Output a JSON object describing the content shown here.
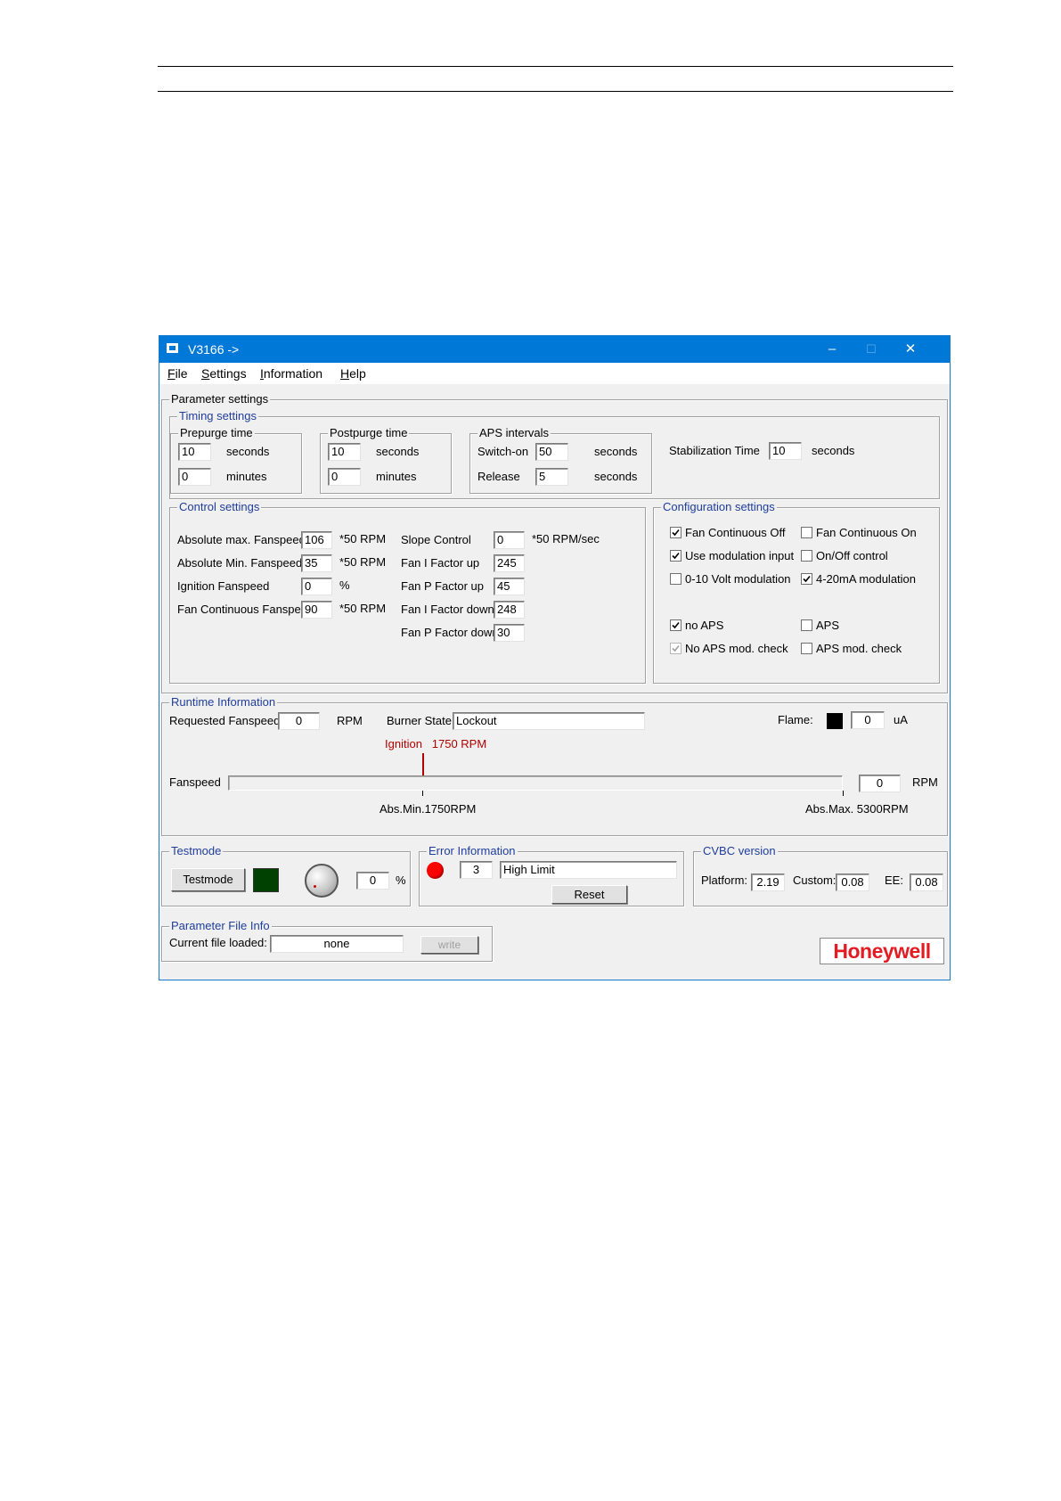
{
  "titlebar": {
    "title": "V3166  ->",
    "minimize": "–",
    "maximize": "☐",
    "close": "✕"
  },
  "menu": [
    "File",
    "Settings",
    "Information",
    "Help"
  ],
  "parameter_settings": {
    "title": "Parameter settings"
  },
  "timing": {
    "title": "Timing settings",
    "prepurge": {
      "title": "Prepurge time",
      "seconds_value": "10",
      "seconds_label": "seconds",
      "minutes_value": "0",
      "minutes_label": "minutes"
    },
    "postpurge": {
      "title": "Postpurge time",
      "seconds_value": "10",
      "seconds_label": "seconds",
      "minutes_value": "0",
      "minutes_label": "minutes"
    },
    "aps": {
      "title": "APS intervals",
      "switch_on_label": "Switch-on",
      "switch_on_value": "50",
      "release_label": "Release",
      "release_value": "5",
      "unit": "seconds"
    },
    "stabilization": {
      "label": "Stabilization Time",
      "value": "10",
      "unit": "seconds"
    }
  },
  "control": {
    "title": "Control settings",
    "left": [
      {
        "label": "Absolute max. Fanspeed",
        "value": "106",
        "unit": "*50 RPM"
      },
      {
        "label": "Absolute Min. Fanspeed",
        "value": "35",
        "unit": "*50 RPM"
      },
      {
        "label": "Ignition Fanspeed",
        "value": "0",
        "unit": "%"
      },
      {
        "label": "Fan Continuous Fanspeed",
        "value": "90",
        "unit": "*50 RPM"
      }
    ],
    "right": [
      {
        "label": "Slope Control",
        "value": "0",
        "unit": "*50 RPM/sec"
      },
      {
        "label": "Fan I Factor up",
        "value": "245",
        "unit": ""
      },
      {
        "label": "Fan P Factor up",
        "value": "45",
        "unit": ""
      },
      {
        "label": "Fan I Factor down",
        "value": "248",
        "unit": ""
      },
      {
        "label": "Fan P Factor down",
        "value": "30",
        "unit": ""
      }
    ]
  },
  "configuration": {
    "title": "Configuration settings",
    "items": [
      {
        "label": "Fan Continuous Off",
        "checked": true,
        "disabled": false
      },
      {
        "label": "Fan Continuous On",
        "checked": false,
        "disabled": false
      },
      {
        "label": "Use modulation input",
        "checked": true,
        "disabled": false
      },
      {
        "label": "On/Off control",
        "checked": false,
        "disabled": false
      },
      {
        "label": "0-10 Volt modulation",
        "checked": false,
        "disabled": false
      },
      {
        "label": "4-20mA modulation",
        "checked": true,
        "disabled": false
      },
      {
        "label": "no APS",
        "checked": true,
        "disabled": false
      },
      {
        "label": "APS",
        "checked": false,
        "disabled": false
      },
      {
        "label": "No APS mod. check",
        "checked": true,
        "disabled": true
      },
      {
        "label": "APS mod. check",
        "checked": false,
        "disabled": false
      }
    ]
  },
  "runtime": {
    "title": "Runtime Information",
    "requested_label": "Requested Fanspeed:",
    "requested_value": "0",
    "requested_unit": "RPM",
    "burner_label": "Burner State:",
    "burner_value": "Lockout",
    "flame_label": "Flame:",
    "flame_value": "0",
    "flame_unit": "uA",
    "ignition_marker": "Ignition   1750 RPM",
    "fanspeed_label": "Fanspeed",
    "fanspeed_value": "0",
    "fanspeed_unit": "RPM",
    "abs_min_label": "Abs.Min.1750RPM",
    "abs_max_label": "Abs.Max. 5300RPM",
    "colors": {
      "ignition": "#b00000",
      "flame_indicator": "#000000"
    }
  },
  "testmode": {
    "title": "Testmode",
    "button": "Testmode",
    "value": "0",
    "unit": "%",
    "indicator_color": "#004000"
  },
  "error": {
    "title": "Error Information",
    "code": "3",
    "text": "High Limit",
    "reset": "Reset",
    "indicator_color": "#ff0000"
  },
  "cvbc": {
    "title": "CVBC version",
    "platform_label": "Platform:",
    "platform_value": "2.19",
    "custom_label": "Custom:",
    "custom_value": "0.08",
    "ee_label": "EE:",
    "ee_value": "0.08"
  },
  "file_info": {
    "title": "Parameter File Info",
    "current_label": "Current file loaded:",
    "current_value": "none",
    "write": "write"
  },
  "logo": {
    "text": "Honeywell",
    "color": "#e31b23"
  }
}
